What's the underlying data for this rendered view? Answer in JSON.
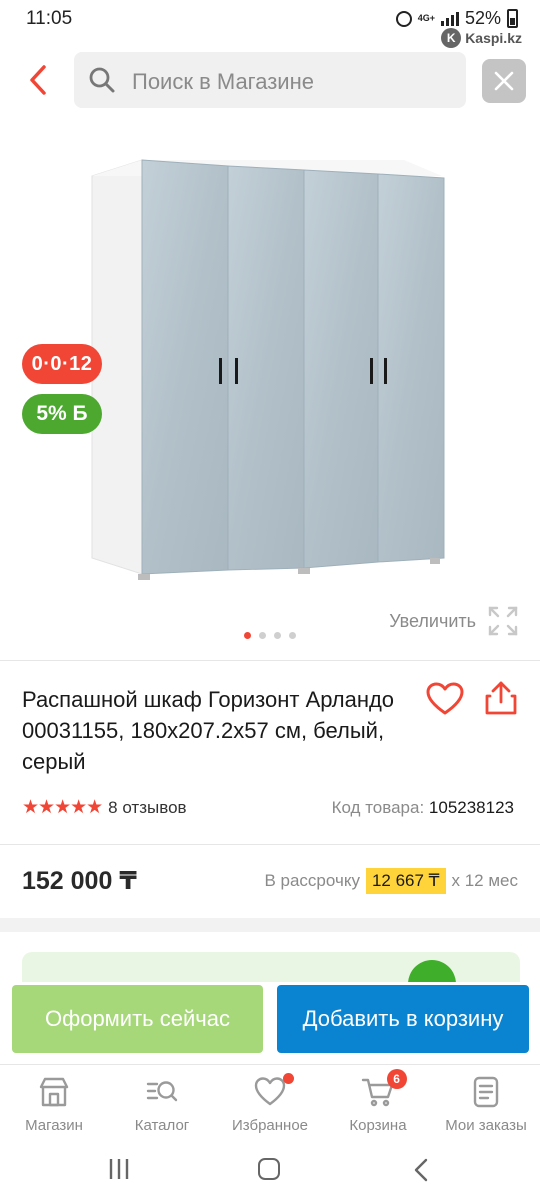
{
  "status_bar": {
    "time": "11:05",
    "network": "4G+",
    "battery": "52%",
    "brand": "Kaspi.kz"
  },
  "header": {
    "search_placeholder": "Поиск в Магазине",
    "back_icon": "chevron-left-icon",
    "clear_icon": "close-icon"
  },
  "gallery": {
    "badge_installment": "0·0·12",
    "badge_bonus": "5% Б",
    "zoom_label": "Увеличить",
    "dots_total": 4,
    "active_dot": 1
  },
  "product": {
    "title": "Распашной шкаф Горизонт Арландо 00031155, 180x207.2x57 см, белый, серый",
    "rating": 5,
    "reviews_label": "8 отзывов",
    "code_label": "Код товара:",
    "code_value": "105238123",
    "price": "152 000 ₸",
    "installment_prefix": "В рассрочку",
    "installment_amount": "12 667 ₸",
    "installment_suffix": "х 12 мес"
  },
  "actions": {
    "order_now": "Оформить сейчас",
    "add_to_cart": "Добавить в корзину"
  },
  "bottom_nav": {
    "items": [
      {
        "label": "Магазин",
        "icon": "store-icon"
      },
      {
        "label": "Каталог",
        "icon": "catalog-search-icon"
      },
      {
        "label": "Избранное",
        "icon": "heart-icon",
        "dot": true
      },
      {
        "label": "Корзина",
        "icon": "cart-icon",
        "count": "6"
      },
      {
        "label": "Мои заказы",
        "icon": "orders-icon"
      }
    ]
  },
  "colors": {
    "accent_red": "#f14635",
    "bonus_green": "#4ca82e",
    "order_button": "#a6d87a",
    "cart_button": "#0a84d0",
    "installment_highlight": "#ffd43b"
  }
}
